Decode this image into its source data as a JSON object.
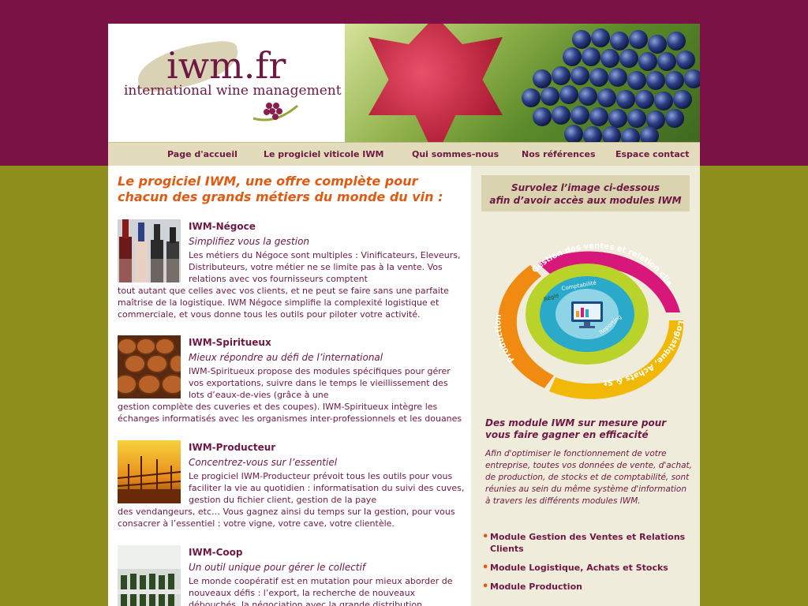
{
  "logo": {
    "word": "iwm.fr",
    "tagline": "international wine management"
  },
  "nav": {
    "items": [
      {
        "label": "Page d'accueil"
      },
      {
        "label": "Le progiciel viticole IWM"
      },
      {
        "label": "Qui sommes-nous"
      },
      {
        "label": "Nos références"
      },
      {
        "label": "Espace contact"
      }
    ]
  },
  "main": {
    "heading": "Le progiciel IWM, une offre complète pour chacun des grands métiers du monde du vin :",
    "products": [
      {
        "title": "IWM-Négoce",
        "subtitle": "Simplifiez vous la gestion",
        "desc_part1": "Les métiers du Négoce sont multiples : Vinificateurs, Eleveurs, Distributeurs, votre métier ne se limite pas à la vente. Vos relations avec vos fournisseurs comptent",
        "desc_part2": "tout autant que celles avec vos clients, et ne peut se faire sans une parfaite maîtrise de la logistique. IWM Négoce simplifie la complexité logistique et commerciale, et vous donne tous les outils pour piloter votre activité."
      },
      {
        "title": "IWM-Spiritueux",
        "subtitle": "Mieux répondre au défi de l’international",
        "desc_part1": "IWM-Spiritueux propose des modules spécifiques pour gérer vos exportations, suivre dans le temps le vieillissement des lots d’eaux-de-vies (grâce à une",
        "desc_part2": "gestion complète des cuveries et des coupes). IWM-Spiritueux intègre les échanges informatisés avec les organismes inter-professionnels et les douanes"
      },
      {
        "title": "IWM-Producteur",
        "subtitle": "Concentrez-vous sur l’essentiel",
        "desc_part1": "Le progiciel IWM-Producteur prévoit tous les outils pour vous faciliter la vie au quotidien : informatisation du suivi des cuves, gestion du fichier client, gestion de la paye",
        "desc_part2": "des vendangeurs, etc… Vous gagnez ainsi du temps sur la gestion, pour vous consacrer à l’essentiel : votre vigne, votre cave, votre clientèle."
      },
      {
        "title": "IWM-Coop",
        "subtitle": "Un outil unique pour gérer le collectif",
        "desc_part1": "Le monde coopératif est en mutation pour mieux aborder de nouveaux défis : l’export, la recherche de nouveaux débouchés, la négociation avec la grande distribution.",
        "desc_part2": ""
      }
    ]
  },
  "sidebar": {
    "callout_line1": "Survolez l’image ci-dessous",
    "callout_line2": "afin d’avoir accès aux modules IWM",
    "diagram": {
      "arc_top": "Gestion des ventes et relation client",
      "arc_right": "Logistique, Achats & Stocks",
      "arc_left": "Production",
      "inner_regie": "Régie",
      "inner_compta": "Comptabilité",
      "inner_reporting": "Reporting"
    },
    "heading": "Des module IWM sur mesure pour vous faire gagner en efficacité",
    "desc": "Afin d'optimiser le fonctionnement de votre entreprise, toutes vos données de vente, d'achat, de production, de stocks et de comptabilité, sont réunies au sein du même système d'information à travers les différents modules IWM.",
    "modules": [
      {
        "label": "Module Gestion des Ventes et Relations Clients"
      },
      {
        "label": "Module Logistique, Achats et Stocks"
      },
      {
        "label": "Module Production"
      }
    ]
  }
}
